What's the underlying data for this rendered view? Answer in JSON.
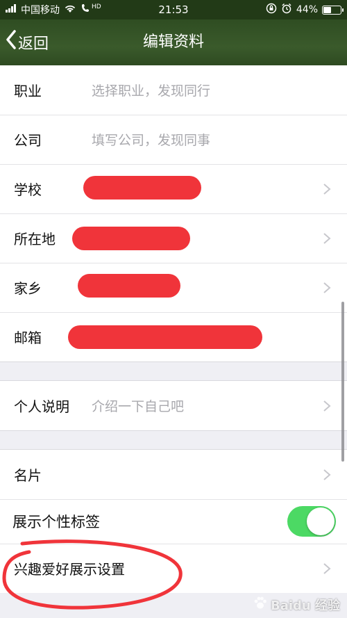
{
  "status_bar": {
    "carrier": "中国移动",
    "network_badge": "HD",
    "time": "21:53",
    "battery": "44%",
    "battery_level": 0.44
  },
  "nav": {
    "back_label": "返回",
    "title": "编辑资料"
  },
  "group1": [
    {
      "label": "职业",
      "placeholder": "选择职业，发现同行"
    },
    {
      "label": "公司",
      "placeholder": "填写公司，发现同事"
    },
    {
      "label": "学校"
    },
    {
      "label": "所在地"
    },
    {
      "label": "家乡"
    },
    {
      "label": "邮箱"
    }
  ],
  "group2": {
    "label": "个人说明",
    "placeholder": "介绍一下自己吧"
  },
  "group3": [
    {
      "label": "名片"
    },
    {
      "label": "展示个性标签",
      "toggle_on": true
    },
    {
      "label": "兴趣爱好展示设置"
    }
  ],
  "colors": {
    "nav_bg": "#3a5a2b",
    "toggle_on": "#4cd964",
    "redaction": "#f0343a",
    "page_bg": "#efeff4"
  },
  "watermark": "Baidu 经验"
}
